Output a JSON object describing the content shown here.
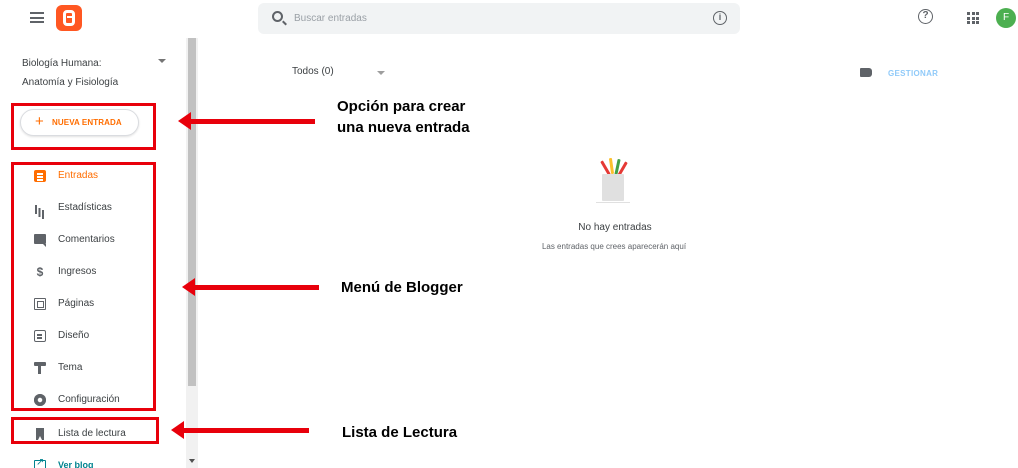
{
  "header": {
    "search_placeholder": "Buscar entradas",
    "info_glyph": "i",
    "help_glyph": "?",
    "avatar_initial": "F",
    "logo_color": "#ff5722",
    "avatar_color": "#4caf50"
  },
  "sidebar": {
    "blog_title_line1": "Biología Humana:",
    "blog_title_line2": "Anatomía y Fisiología",
    "new_post": {
      "plus": "+",
      "label": "NUEVA ENTRADA"
    },
    "items": [
      {
        "label": "Entradas",
        "icon": "posts-icon",
        "active": true
      },
      {
        "label": "Estadísticas",
        "icon": "stats-icon"
      },
      {
        "label": "Comentarios",
        "icon": "comments-icon"
      },
      {
        "label": "Ingresos",
        "icon": "earnings-icon"
      },
      {
        "label": "Páginas",
        "icon": "pages-icon"
      },
      {
        "label": "Diseño",
        "icon": "layout-icon"
      },
      {
        "label": "Tema",
        "icon": "theme-icon"
      },
      {
        "label": "Configuración",
        "icon": "settings-icon"
      }
    ],
    "reading_list": {
      "label": "Lista de lectura",
      "icon": "reading-list-icon"
    },
    "view_blog": {
      "label": "Ver blog",
      "icon": "view-blog-icon"
    }
  },
  "main": {
    "filter_label": "Todos (0)",
    "manage_label": "GESTIONAR",
    "empty_title": "No hay entradas",
    "empty_subtitle": "Las entradas que crees aparecerán aquí"
  },
  "annotations": {
    "new_post_line1": "Opción para crear",
    "new_post_line2": "una nueva entrada",
    "menu": "Menú de Blogger",
    "reading_list": "Lista de Lectura",
    "color": "#e8000b"
  },
  "colors": {
    "accent": "#ff6d00",
    "link_teal": "#00838f",
    "manage_disabled": "#90caf9"
  }
}
